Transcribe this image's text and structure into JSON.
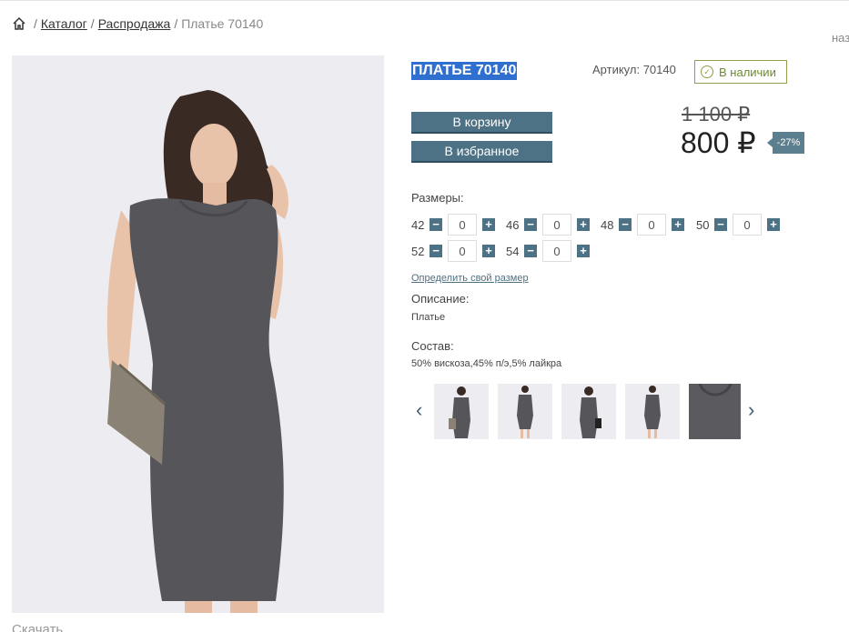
{
  "breadcrumb": {
    "home_icon": "home-icon",
    "separator": "/",
    "catalog": "Каталог",
    "sale": "Распродажа",
    "current": "Платье 70140"
  },
  "back_link": "назад",
  "product": {
    "title": "ПЛАТЬЕ 70140",
    "sku": "Артикул: 70140",
    "stock": "В наличии",
    "add_to_cart": "В корзину",
    "add_to_favorites": "В избранное",
    "old_price": "1 100 ₽",
    "new_price": "800 ₽",
    "discount": "-27%"
  },
  "sizes": {
    "label": "Размеры:",
    "items": [
      {
        "size": "42",
        "qty": "0"
      },
      {
        "size": "46",
        "qty": "0"
      },
      {
        "size": "48",
        "qty": "0"
      },
      {
        "size": "50",
        "qty": "0"
      },
      {
        "size": "52",
        "qty": "0"
      },
      {
        "size": "54",
        "qty": "0"
      }
    ],
    "find_size_link": "Определить свой размер"
  },
  "description": {
    "label": "Описание:",
    "text": "Платье"
  },
  "composition": {
    "label": "Состав:",
    "text": "50% вискоза,45% п/э,5% лайкра"
  },
  "gallery": {
    "prev_icon": "chevron-left-icon",
    "next_icon": "chevron-right-icon",
    "thumbnail_count": 5
  },
  "download": "Скачать",
  "colors": {
    "button": "#4d7185",
    "stock_border": "#8ea04a",
    "title_highlight": "#2f6fcf",
    "dress": "#55555a",
    "photo_bg": "#ececf1"
  }
}
